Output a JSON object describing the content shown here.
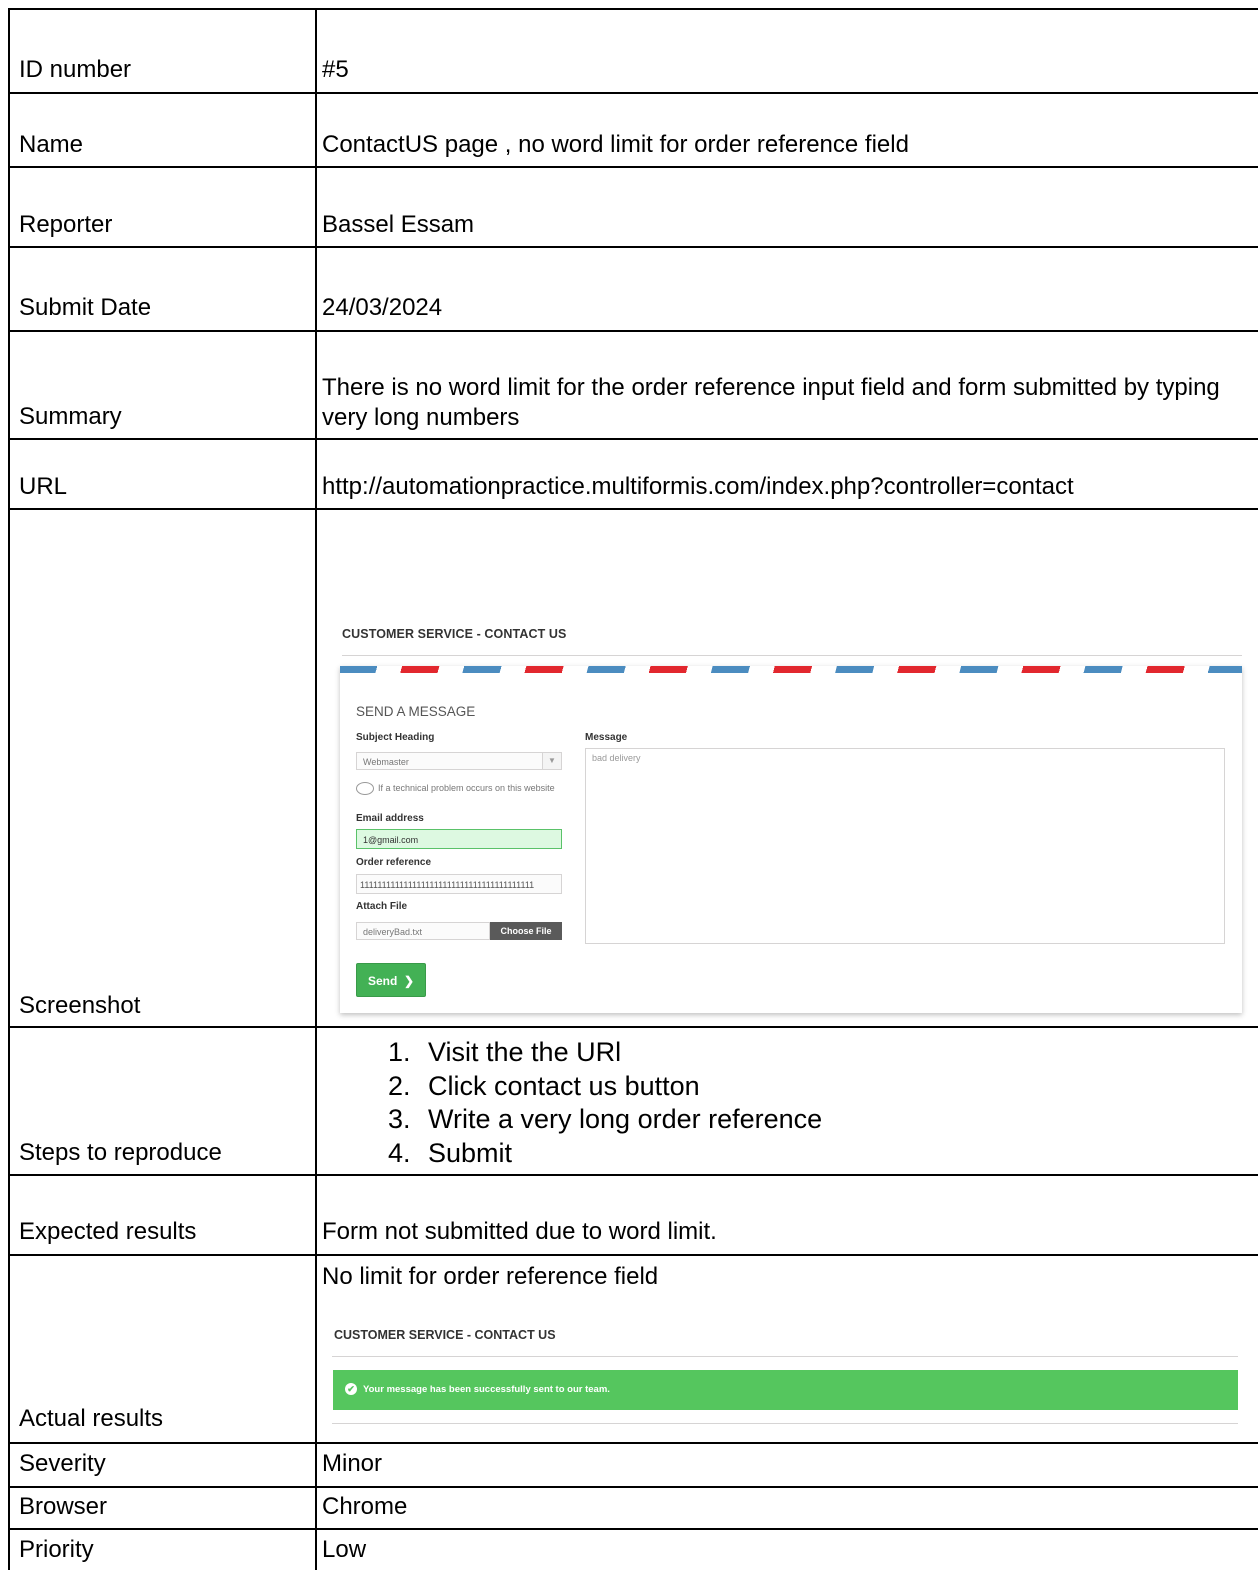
{
  "rows": {
    "id": {
      "label": "ID number",
      "value": "#5"
    },
    "name": {
      "label": "Name",
      "value": "ContactUS page , no word limit for order reference field"
    },
    "reporter": {
      "label": "Reporter",
      "value": "Bassel Essam"
    },
    "submit_date": {
      "label": "Submit Date",
      "value": "24/03/2024"
    },
    "summary": {
      "label": "Summary",
      "value": "There is no word limit for the order reference input field and form submitted by typing very long numbers"
    },
    "url": {
      "label": "URL",
      "value": "http://automationpractice.multiformis.com/index.php?controller=contact"
    },
    "screenshot": {
      "label": "Screenshot"
    },
    "steps": {
      "label": "Steps to reproduce",
      "items": [
        "Visit the the URl",
        "Click contact us button",
        "Write a very long order reference",
        "Submit"
      ]
    },
    "expected": {
      "label": "Expected results",
      "value": "Form not submitted due to word limit."
    },
    "actual": {
      "label": "Actual results",
      "value": "No limit for order reference field"
    },
    "severity": {
      "label": "Severity",
      "value": "Minor"
    },
    "browser": {
      "label": "Browser",
      "value": "Chrome"
    },
    "priority": {
      "label": "Priority",
      "value": "Low"
    }
  },
  "contact_form": {
    "heading": "CUSTOMER SERVICE - CONTACT US",
    "card_title": "SEND A MESSAGE",
    "subject_label": "Subject Heading",
    "subject_value": "Webmaster",
    "subject_hint": "If a technical problem occurs on this website",
    "email_label": "Email address",
    "email_value": "1@gmail.com",
    "order_label": "Order reference",
    "order_value": "1111111111111111111111111111111111111111",
    "attach_label": "Attach File",
    "attach_value": "deliveryBad.txt",
    "choose_file": "Choose File",
    "message_label": "Message",
    "message_value": "bad delivery",
    "send_label": "Send",
    "airmail_colors": [
      "#4b8cc0",
      "#e2272e"
    ],
    "send_color": "#43b155"
  },
  "result_screen": {
    "heading": "CUSTOMER SERVICE - CONTACT US",
    "success_message": "Your message has been successfully sent to our team.",
    "success_color": "#55c65e"
  }
}
